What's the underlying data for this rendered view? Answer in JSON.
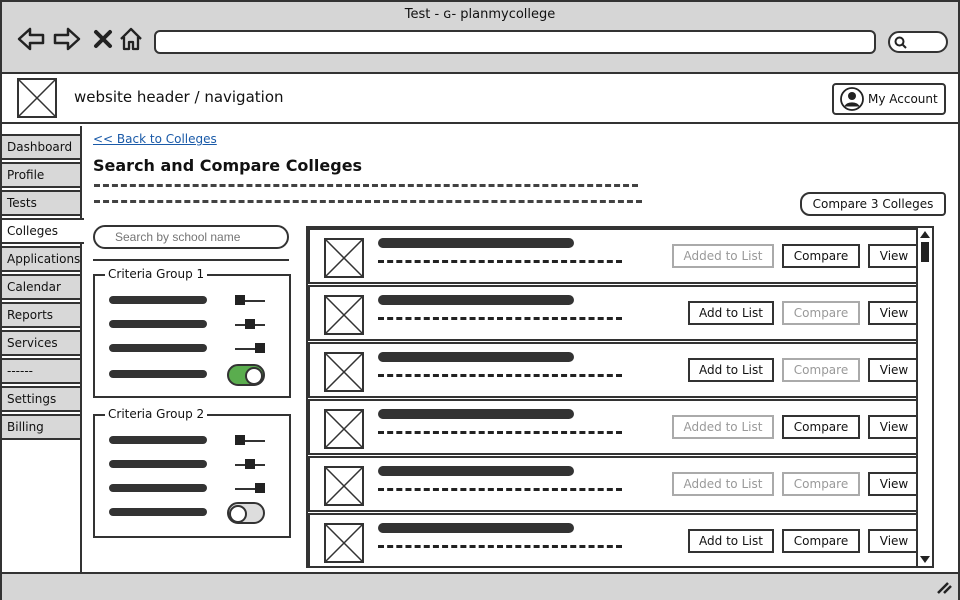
{
  "window": {
    "title": "Test - ɢ- planmycollege"
  },
  "toolbar": {
    "icons": [
      "back-arrow-icon",
      "forward-arrow-icon",
      "close-x-icon",
      "home-icon"
    ]
  },
  "header": {
    "text": "website header / navigation",
    "account_label": "My Account"
  },
  "sidebar": {
    "items": [
      {
        "label": "Dashboard"
      },
      {
        "label": "Profile"
      },
      {
        "label": "Tests"
      },
      {
        "label": "Colleges"
      },
      {
        "label": "Applications"
      },
      {
        "label": "Calendar"
      },
      {
        "label": "Reports"
      },
      {
        "label": "Services"
      },
      {
        "label": "------"
      },
      {
        "label": "Settings"
      },
      {
        "label": "Billing"
      }
    ]
  },
  "main": {
    "back_link": "<< Back to Colleges",
    "title": "Search and Compare Colleges",
    "compare_button": "Compare 3 Colleges",
    "search_placeholder": "Search by school name"
  },
  "filters": {
    "group1": {
      "legend": "Criteria Group 1",
      "toggle_on": true
    },
    "group2": {
      "legend": "Criteria Group 2",
      "toggle_on": false
    }
  },
  "results": [
    {
      "add": "Added to List",
      "add_disabled": true,
      "compare": "Compare",
      "compare_disabled": false,
      "view": "View"
    },
    {
      "add": "Add to List",
      "add_disabled": false,
      "compare": "Compare",
      "compare_disabled": true,
      "view": "View"
    },
    {
      "add": "Add to List",
      "add_disabled": false,
      "compare": "Compare",
      "compare_disabled": true,
      "view": "View"
    },
    {
      "add": "Added to List",
      "add_disabled": true,
      "compare": "Compare",
      "compare_disabled": false,
      "view": "View"
    },
    {
      "add": "Added to List",
      "add_disabled": true,
      "compare": "Compare",
      "compare_disabled": true,
      "view": "View"
    },
    {
      "add": "Add to List",
      "add_disabled": false,
      "compare": "Compare",
      "compare_disabled": false,
      "view": "View"
    }
  ]
}
